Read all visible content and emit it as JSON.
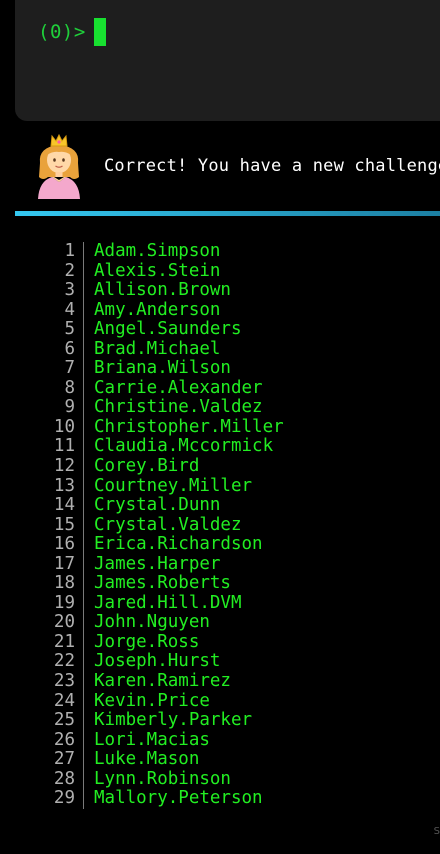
{
  "terminal": {
    "prompt": "(0)>"
  },
  "message": {
    "text": "Correct! You have a new challenge"
  },
  "list": [
    {
      "num": "1",
      "name": "Adam.Simpson"
    },
    {
      "num": "2",
      "name": "Alexis.Stein"
    },
    {
      "num": "3",
      "name": "Allison.Brown"
    },
    {
      "num": "4",
      "name": "Amy.Anderson"
    },
    {
      "num": "5",
      "name": "Angel.Saunders"
    },
    {
      "num": "6",
      "name": "Brad.Michael"
    },
    {
      "num": "7",
      "name": "Briana.Wilson"
    },
    {
      "num": "8",
      "name": "Carrie.Alexander"
    },
    {
      "num": "9",
      "name": "Christine.Valdez"
    },
    {
      "num": "10",
      "name": "Christopher.Miller"
    },
    {
      "num": "11",
      "name": "Claudia.Mccormick"
    },
    {
      "num": "12",
      "name": "Corey.Bird"
    },
    {
      "num": "13",
      "name": "Courtney.Miller"
    },
    {
      "num": "14",
      "name": "Crystal.Dunn"
    },
    {
      "num": "15",
      "name": "Crystal.Valdez"
    },
    {
      "num": "16",
      "name": "Erica.Richardson"
    },
    {
      "num": "17",
      "name": "James.Harper"
    },
    {
      "num": "18",
      "name": "James.Roberts"
    },
    {
      "num": "19",
      "name": "Jared.Hill.DVM"
    },
    {
      "num": "20",
      "name": "John.Nguyen"
    },
    {
      "num": "21",
      "name": "Jorge.Ross"
    },
    {
      "num": "22",
      "name": "Joseph.Hurst"
    },
    {
      "num": "23",
      "name": "Karen.Ramirez"
    },
    {
      "num": "24",
      "name": "Kevin.Price"
    },
    {
      "num": "25",
      "name": "Kimberly.Parker"
    },
    {
      "num": "26",
      "name": "Lori.Macias"
    },
    {
      "num": "27",
      "name": "Luke.Mason"
    },
    {
      "num": "28",
      "name": "Lynn.Robinson"
    },
    {
      "num": "29",
      "name": "Mallory.Peterson"
    }
  ],
  "corner": {
    "char": "S"
  },
  "colors": {
    "prompt": "#1fcf3a",
    "cursor": "#18e030",
    "list_name": "#22ee22",
    "divider": "#35c8f0"
  }
}
